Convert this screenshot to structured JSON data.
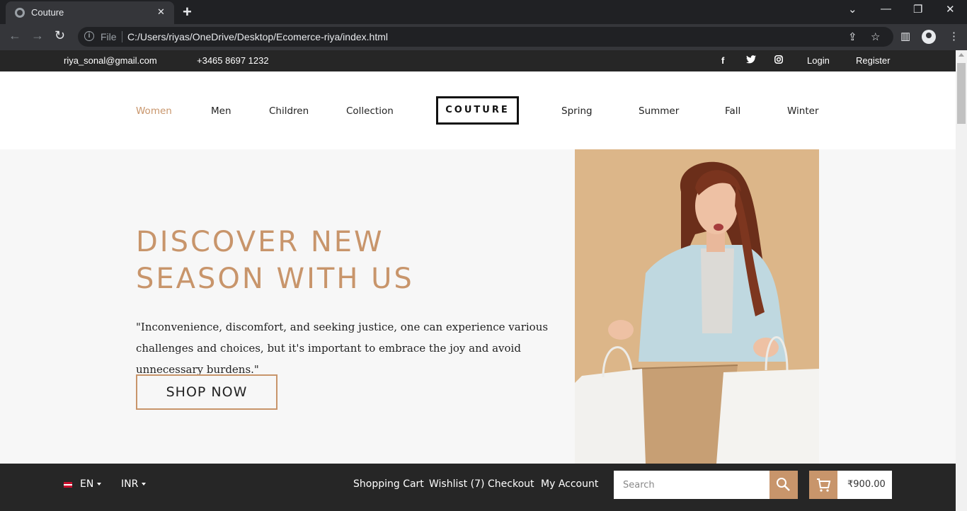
{
  "browser": {
    "tab_title": "Couture",
    "url_scheme": "File",
    "url": "C:/Users/riyas/OneDrive/Desktop/Ecomerce-riya/index.html"
  },
  "topbar": {
    "email": "riya_sonal@gmail.com",
    "phone": "+3465 8697 1232",
    "social": [
      "facebook-icon",
      "twitter-icon",
      "instagram-icon"
    ],
    "login": "Login",
    "register": "Register"
  },
  "nav": {
    "items": [
      "Women",
      "Men",
      "Children",
      "Collection",
      "Spring",
      "Summer",
      "Fall",
      "Winter"
    ],
    "active": "Women",
    "logo": "COUTURE"
  },
  "hero": {
    "title_line1": "DISCOVER NEW",
    "title_line2": "SEASON WITH US",
    "text": "\"Inconvenience, discomfort, and seeking justice, one can experience various challenges and choices, but it's important to embrace the joy and avoid unnecessary burdens.\"",
    "button": "SHOP NOW"
  },
  "footerbar": {
    "language": "EN",
    "currency": "INR",
    "links": [
      "Shopping Cart",
      "Wishlist (7)",
      "Checkout",
      "My Account"
    ],
    "search_placeholder": "Search",
    "cart_total": "₹900.00"
  },
  "colors": {
    "accent": "#c8956b",
    "dark": "#262626",
    "hero_bg": "#f7f7f7"
  }
}
